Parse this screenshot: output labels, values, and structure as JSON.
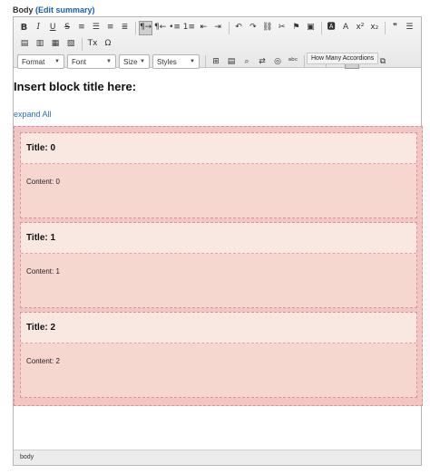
{
  "field": {
    "label": "Body",
    "link": "(Edit summary)"
  },
  "toolbar": {
    "row1": [
      {
        "name": "bold-button",
        "glyph": "B",
        "cls": "bold"
      },
      {
        "name": "italic-button",
        "glyph": "I",
        "cls": "ital"
      },
      {
        "name": "underline-button",
        "glyph": "U",
        "cls": "under"
      },
      {
        "name": "strike-button",
        "glyph": "S",
        "cls": "strike"
      },
      {
        "name": "align-left-button",
        "glyph": "≡",
        "cls": ""
      },
      {
        "name": "align-center-button",
        "glyph": "☰",
        "cls": ""
      },
      {
        "name": "align-right-button",
        "glyph": "≡",
        "cls": ""
      },
      {
        "name": "justify-button",
        "glyph": "≣",
        "cls": ""
      },
      {
        "name": "ltr-button",
        "glyph": "¶→",
        "cls": "on"
      },
      {
        "name": "rtl-button",
        "glyph": "¶←",
        "cls": ""
      },
      {
        "name": "bullet-list-button",
        "glyph": "•≡",
        "cls": ""
      },
      {
        "name": "numbered-list-button",
        "glyph": "1≡",
        "cls": ""
      },
      {
        "name": "outdent-button",
        "glyph": "⇤",
        "cls": ""
      },
      {
        "name": "indent-button",
        "glyph": "⇥",
        "cls": ""
      },
      {
        "name": "undo-button",
        "glyph": "↶",
        "cls": ""
      },
      {
        "name": "redo-button",
        "glyph": "↷",
        "cls": ""
      },
      {
        "name": "link-button",
        "glyph": "⛓",
        "cls": ""
      },
      {
        "name": "unlink-button",
        "glyph": "✂",
        "cls": ""
      },
      {
        "name": "anchor-button",
        "glyph": "⚑",
        "cls": ""
      },
      {
        "name": "image-button",
        "glyph": "▣",
        "cls": ""
      },
      {
        "name": "background-color-button",
        "glyph": "🅰",
        "cls": ""
      },
      {
        "name": "text-color-button",
        "glyph": "A",
        "cls": ""
      },
      {
        "name": "superscript-button",
        "glyph": "x²",
        "cls": ""
      },
      {
        "name": "subscript-button",
        "glyph": "x₂",
        "cls": ""
      },
      {
        "name": "blockquote-button",
        "glyph": "❞",
        "cls": ""
      },
      {
        "name": "horizontal-rule-button",
        "glyph": "☰",
        "cls": ""
      }
    ],
    "row2": [
      {
        "name": "cut-button",
        "glyph": "▤",
        "cls": ""
      },
      {
        "name": "copy-button",
        "glyph": "▥",
        "cls": ""
      },
      {
        "name": "paste-button",
        "glyph": "▦",
        "cls": ""
      },
      {
        "name": "paste-text-button",
        "glyph": "▧",
        "cls": ""
      },
      {
        "name": "remove-format-button",
        "glyph": "Tx",
        "cls": ""
      },
      {
        "name": "special-char-button",
        "glyph": "Ω",
        "cls": ""
      }
    ],
    "combos": [
      {
        "name": "format-select",
        "label": "Format",
        "width": 52
      },
      {
        "name": "font-select",
        "label": "Font",
        "width": 54
      },
      {
        "name": "size-select",
        "label": "Size",
        "width": 34
      },
      {
        "name": "styles-select",
        "label": "Styles",
        "width": 52
      }
    ],
    "row3": [
      {
        "name": "table-button",
        "glyph": "⊞",
        "cls": ""
      },
      {
        "name": "template-button",
        "glyph": "▤",
        "cls": ""
      },
      {
        "name": "find-button",
        "glyph": "⌕",
        "cls": ""
      },
      {
        "name": "replace-button",
        "glyph": "⇄",
        "cls": ""
      },
      {
        "name": "iframe-button",
        "glyph": "◎",
        "cls": ""
      },
      {
        "name": "spellcheck-button",
        "glyph": "ᵃᵇᶜ",
        "cls": ""
      },
      {
        "name": "source-button",
        "glyph": "⎘",
        "cls": ""
      },
      {
        "name": "show-blocks-button",
        "glyph": "▥",
        "cls": ""
      },
      {
        "name": "accordion-button",
        "glyph": "▤",
        "cls": "on"
      },
      {
        "name": "media-button",
        "glyph": "▣",
        "cls": ""
      },
      {
        "name": "maximize-button",
        "glyph": "⧉",
        "cls": ""
      }
    ]
  },
  "tooltip": "How Many Accordions",
  "content": {
    "block_title": "Insert block title here:",
    "expand_all": "expand All",
    "items": [
      {
        "title": "Title: 0",
        "content": "Content: 0"
      },
      {
        "title": "Title: 1",
        "content": "Content: 1"
      },
      {
        "title": "Title: 2",
        "content": "Content: 2"
      }
    ]
  },
  "statusbar": "body"
}
